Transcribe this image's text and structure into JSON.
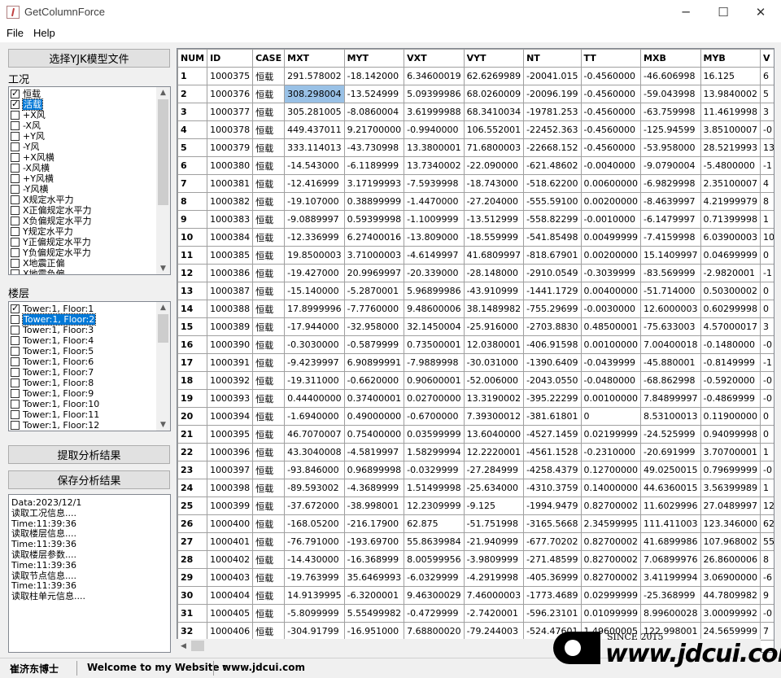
{
  "window": {
    "title": "GetColumnForce",
    "icons": {
      "app": "app-icon",
      "minimize": "minimize-icon",
      "maximize": "maximize-icon",
      "close": "close-icon"
    }
  },
  "menu": [
    "File",
    "Help"
  ],
  "buttons": {
    "select_model": "选择YJK模型文件",
    "extract": "提取分析结果",
    "save": "保存分析结果"
  },
  "load_case_label": "工况",
  "load_cases": [
    {
      "label": "恒载",
      "checked": true,
      "selected": false
    },
    {
      "label": "活载",
      "checked": true,
      "selected": true
    },
    {
      "label": "+X风",
      "checked": false,
      "selected": false
    },
    {
      "label": "-X风",
      "checked": false,
      "selected": false
    },
    {
      "label": "+Y风",
      "checked": false,
      "selected": false
    },
    {
      "label": "-Y风",
      "checked": false,
      "selected": false
    },
    {
      "label": "+X风横",
      "checked": false,
      "selected": false
    },
    {
      "label": "-X风横",
      "checked": false,
      "selected": false
    },
    {
      "label": "+Y风横",
      "checked": false,
      "selected": false
    },
    {
      "label": "-Y风横",
      "checked": false,
      "selected": false
    },
    {
      "label": "X规定水平力",
      "checked": false,
      "selected": false
    },
    {
      "label": "X正偏规定水平力",
      "checked": false,
      "selected": false
    },
    {
      "label": "X负偏规定水平力",
      "checked": false,
      "selected": false
    },
    {
      "label": "Y规定水平力",
      "checked": false,
      "selected": false
    },
    {
      "label": "Y正偏规定水平力",
      "checked": false,
      "selected": false
    },
    {
      "label": "Y负偏规定水平力",
      "checked": false,
      "selected": false
    },
    {
      "label": "X地震正偏",
      "checked": false,
      "selected": false
    },
    {
      "label": "X地震负偏",
      "checked": false,
      "selected": false
    }
  ],
  "floor_label": "楼层",
  "floors": [
    {
      "label": "Tower:1, Floor:1",
      "checked": true,
      "selected": false
    },
    {
      "label": "Tower:1, Floor:2",
      "checked": false,
      "selected": true
    },
    {
      "label": "Tower:1, Floor:3",
      "checked": false,
      "selected": false
    },
    {
      "label": "Tower:1, Floor:4",
      "checked": false,
      "selected": false
    },
    {
      "label": "Tower:1, Floor:5",
      "checked": false,
      "selected": false
    },
    {
      "label": "Tower:1, Floor:6",
      "checked": false,
      "selected": false
    },
    {
      "label": "Tower:1, Floor:7",
      "checked": false,
      "selected": false
    },
    {
      "label": "Tower:1, Floor:8",
      "checked": false,
      "selected": false
    },
    {
      "label": "Tower:1, Floor:9",
      "checked": false,
      "selected": false
    },
    {
      "label": "Tower:1, Floor:10",
      "checked": false,
      "selected": false
    },
    {
      "label": "Tower:1, Floor:11",
      "checked": false,
      "selected": false
    },
    {
      "label": "Tower:1, Floor:12",
      "checked": false,
      "selected": false
    }
  ],
  "log": [
    "Data:2023/12/1",
    "读取工况信息....",
    "Time:11:39:36",
    "读取楼层信息....",
    "Time:11:39:36",
    "读取楼层参数....",
    "Time:11:39:36",
    "读取节点信息....",
    "Time:11:39:36",
    "读取柱单元信息...."
  ],
  "table": {
    "columns": [
      "NUM",
      "ID",
      "CASE",
      "MXT",
      "MYT",
      "VXT",
      "VYT",
      "NT",
      "TT",
      "MXB",
      "MYB",
      "V"
    ],
    "selected_cell": {
      "row": 1,
      "col": 3
    },
    "rows": [
      [
        "1",
        "1000375",
        "恒载",
        "291.578002",
        "-18.142000",
        "6.34600019",
        "62.6269989",
        "-20041.015",
        "-0.4560000",
        "-46.606998",
        "16.125",
        "6"
      ],
      [
        "2",
        "1000376",
        "恒载",
        "308.298004",
        "-13.524999",
        "5.09399986",
        "68.0260009",
        "-20096.199",
        "-0.4560000",
        "-59.043998",
        "13.9840002",
        "5"
      ],
      [
        "3",
        "1000377",
        "恒载",
        "305.281005",
        "-8.0860004",
        "3.61999988",
        "68.3410034",
        "-19781.253",
        "-0.4560000",
        "-63.759998",
        "11.4619998",
        "3"
      ],
      [
        "4",
        "1000378",
        "恒载",
        "449.437011",
        "9.21700000",
        "-0.9940000",
        "106.552001",
        "-22452.363",
        "-0.4560000",
        "-125.94599",
        "3.85100007",
        "-0"
      ],
      [
        "5",
        "1000379",
        "恒载",
        "333.114013",
        "-43.730998",
        "13.3800001",
        "71.6800003",
        "-22668.152",
        "-0.4560000",
        "-53.958000",
        "28.5219993",
        "13"
      ],
      [
        "6",
        "1000380",
        "恒载",
        "-14.543000",
        "-6.1189999",
        "13.7340002",
        "-22.090000",
        "-621.48602",
        "-0.0040000",
        "-9.0790004",
        "-5.4800000",
        "-1"
      ],
      [
        "7",
        "1000381",
        "恒载",
        "-12.416999",
        "3.17199993",
        "-7.5939998",
        "-18.743000",
        "-518.62200",
        "0.00600000",
        "-6.9829998",
        "2.35100007",
        "4"
      ],
      [
        "8",
        "1000382",
        "恒载",
        "-19.107000",
        "0.38899999",
        "-1.4470000",
        "-27.204000",
        "-555.59100",
        "0.00200000",
        "-8.4639997",
        "4.21999979",
        "8"
      ],
      [
        "9",
        "1000383",
        "恒载",
        "-9.0889997",
        "0.59399998",
        "-1.1009999",
        "-13.512999",
        "-558.82299",
        "-0.0010000",
        "-6.1479997",
        "0.71399998",
        "1"
      ],
      [
        "10",
        "1000384",
        "恒载",
        "-12.336999",
        "6.27400016",
        "-13.809000",
        "-18.559999",
        "-541.85498",
        "0.00499999",
        "-7.4159998",
        "6.03900003",
        "10"
      ],
      [
        "11",
        "1000385",
        "恒载",
        "19.8500003",
        "3.71000003",
        "-4.6149997",
        "41.6809997",
        "-818.67901",
        "0.00200000",
        "15.1409997",
        "0.04699999",
        "0"
      ],
      [
        "12",
        "1000386",
        "恒载",
        "-19.427000",
        "20.9969997",
        "-20.339000",
        "-28.148000",
        "-2910.0549",
        "-0.3039999",
        "-83.569999",
        "-2.9820001",
        "-1"
      ],
      [
        "13",
        "1000387",
        "恒载",
        "-15.140000",
        "-5.2870001",
        "5.96899986",
        "-43.910999",
        "-1441.1729",
        "0.00400000",
        "-51.714000",
        "0.50300002",
        "0"
      ],
      [
        "14",
        "1000388",
        "恒载",
        "17.8999996",
        "-7.7760000",
        "9.48600006",
        "38.1489982",
        "-755.29699",
        "-0.0030000",
        "12.6000003",
        "0.60299998",
        "0"
      ],
      [
        "15",
        "1000389",
        "恒载",
        "-17.944000",
        "-32.958000",
        "32.1450004",
        "-25.916000",
        "-2703.8830",
        "0.48500001",
        "-75.633003",
        "4.57000017",
        "3"
      ],
      [
        "16",
        "1000390",
        "恒载",
        "-0.3030000",
        "-0.5879999",
        "0.73500001",
        "12.0380001",
        "-406.91598",
        "0.00100000",
        "7.00400018",
        "-0.1480000",
        "-0"
      ],
      [
        "17",
        "1000391",
        "恒载",
        "-9.4239997",
        "6.90899991",
        "-7.9889998",
        "-30.031000",
        "-1390.6409",
        "-0.0439999",
        "-45.880001",
        "-0.8149999",
        "-1"
      ],
      [
        "18",
        "1000392",
        "恒载",
        "-19.311000",
        "-0.6620000",
        "0.90600001",
        "-52.006000",
        "-2043.0550",
        "-0.0480000",
        "-68.862998",
        "-0.5920000",
        "-0"
      ],
      [
        "19",
        "1000393",
        "恒载",
        "0.44400000",
        "0.37400001",
        "0.02700000",
        "13.3190002",
        "-395.22299",
        "0.00100000",
        "7.84899997",
        "-0.4869999",
        "-0"
      ],
      [
        "20",
        "1000394",
        "恒载",
        "-1.6940000",
        "0.49000000",
        "-0.6700000",
        "7.39300012",
        "-381.61801",
        "0",
        "8.53100013",
        "0.11900000",
        "0"
      ],
      [
        "21",
        "1000395",
        "恒载",
        "46.7070007",
        "0.75400000",
        "0.03599999",
        "13.6040000",
        "-4527.1459",
        "0.02199999",
        "-24.525999",
        "0.94099998",
        "0"
      ],
      [
        "22",
        "1000396",
        "恒载",
        "43.3040008",
        "-4.5819997",
        "1.58299994",
        "12.2220001",
        "-4561.1528",
        "-0.2310000",
        "-20.691999",
        "3.70700001",
        "1"
      ],
      [
        "23",
        "1000397",
        "恒载",
        "-93.846000",
        "0.96899998",
        "-0.0329999",
        "-27.284999",
        "-4258.4379",
        "0.12700000",
        "49.0250015",
        "0.79699999",
        "-0"
      ],
      [
        "24",
        "1000398",
        "恒载",
        "-89.593002",
        "-4.3689999",
        "1.51499998",
        "-25.634000",
        "-4310.3759",
        "0.14000000",
        "44.6360015",
        "3.56399989",
        "1"
      ],
      [
        "25",
        "1000399",
        "恒载",
        "-37.672000",
        "-38.998001",
        "12.2309999",
        "-9.125",
        "-1994.9479",
        "0.82700002",
        "11.6029996",
        "27.0489997",
        "12"
      ],
      [
        "26",
        "1000400",
        "恒载",
        "-168.05200",
        "-216.17900",
        "62.875",
        "-51.751998",
        "-3165.5668",
        "2.34599995",
        "111.411003",
        "123.346000",
        "62"
      ],
      [
        "27",
        "1000401",
        "恒载",
        "-76.791000",
        "-193.69700",
        "55.8639984",
        "-21.940999",
        "-677.70202",
        "0.82700002",
        "41.6899986",
        "107.968002",
        "55"
      ],
      [
        "28",
        "1000402",
        "恒载",
        "-14.430000",
        "-16.368999",
        "8.00599956",
        "-3.9809999",
        "-271.48599",
        "0.82700002",
        "7.06899976",
        "26.8600006",
        "8"
      ],
      [
        "29",
        "1000403",
        "恒载",
        "-19.763999",
        "35.6469993",
        "-6.0329999",
        "-4.2919998",
        "-405.36999",
        "0.82700002",
        "3.41199994",
        "3.06900000",
        "-6"
      ],
      [
        "30",
        "1000404",
        "恒载",
        "14.9139995",
        "-6.3200001",
        "9.46300029",
        "7.46000003",
        "-1773.4689",
        "0.02999999",
        "-25.368999",
        "44.7809982",
        "9"
      ],
      [
        "31",
        "1000405",
        "恒载",
        "-5.8099999",
        "5.55499982",
        "-0.4729999",
        "-2.7420001",
        "-596.23101",
        "0.01099999",
        "8.99600028",
        "3.00099992",
        "-0"
      ],
      [
        "32",
        "1000406",
        "恒载",
        "-304.91799",
        "-16.951000",
        "7.68800020",
        "-79.244003",
        "-524.47601",
        "1.49600005",
        "122.998001",
        "24.5659999",
        "7"
      ]
    ]
  },
  "status": {
    "author": "崔济东博士",
    "welcome": "Welcome to my Website :",
    "website": "www.jdcui.com"
  },
  "watermark": {
    "since": "SINCE 2015",
    "url": "www.jdcui.com"
  }
}
